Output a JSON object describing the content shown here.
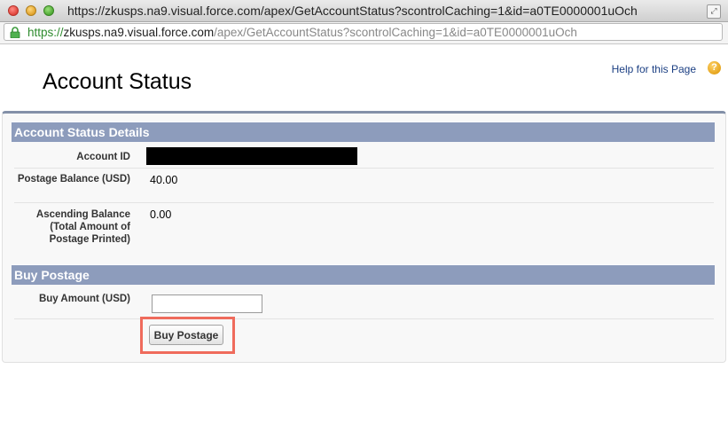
{
  "window": {
    "title": "https://zkusps.na9.visual.force.com/apex/GetAccountStatus?scontrolCaching=1&id=a0TE0000001uOch"
  },
  "address_bar": {
    "scheme": "https://",
    "host": "zkusps.na9.visual.force.com",
    "path": "/apex/GetAccountStatus?scontrolCaching=1&id=a0TE0000001uOch"
  },
  "page": {
    "title": "Account Status",
    "help_link": "Help for this Page",
    "help_icon": "?"
  },
  "account_details": {
    "header": "Account Status Details",
    "account_id_label": "Account ID",
    "postage_balance_label": "Postage Balance (USD)",
    "postage_balance_value": "40.00",
    "ascending_balance_label": "Ascending Balance (Total Amount of Postage Printed)",
    "ascending_balance_value": "0.00"
  },
  "buy_postage": {
    "header": "Buy Postage",
    "amount_label": "Buy Amount (USD)",
    "amount_value": "",
    "button_label": "Buy Postage"
  },
  "colors": {
    "section_header": "#8d9cbc",
    "highlight": "#ef6b5c",
    "link": "#1b3f83"
  }
}
